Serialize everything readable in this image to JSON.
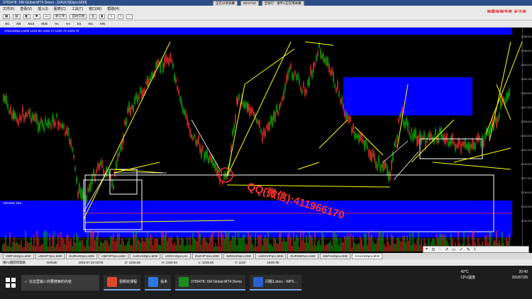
{
  "window": {
    "title": "3765478: XM Global-MT4 Demo - [XAUUSDpro,M30]"
  },
  "top_banner": [
    "正在分享屏幕",
    "00:07:53",
    "全局行 · 请平A正在用屏幕"
  ],
  "red_note": "屏幕录像专家 未注册",
  "menu": [
    "文件(F)",
    "查看(V)",
    "插入(I)",
    "图表(C)",
    "工具(T)",
    "窗口(W)",
    "帮助(H)"
  ],
  "toolbar": {
    "new_order": "新订单",
    "auto_trade": "自动交易"
  },
  "timeframes": [
    "M1",
    "M5",
    "M15",
    "M30",
    "H1",
    "H4",
    "D1",
    "W1",
    "MN"
  ],
  "chart": {
    "symbol_label": "XAUUSDpro,M30 1223.66 1223.72 1222.78 1223.70",
    "volume_label": "Volumes 164",
    "price_labels": [
      "1238.00",
      "1235.00",
      "1233.00",
      "1231.00",
      "1229.00",
      "1227.00",
      "1225.00",
      "1223.00",
      "1221.00",
      "1219.00",
      "1217.00",
      "1215.00",
      "1213.00",
      "1211.00"
    ],
    "watermark": "QQ(微信):411966170"
  },
  "colors": {
    "bull_candle": "#00c000",
    "bear_candle": "#ff3030",
    "zone": "#0000ff",
    "line": "#ffff00",
    "box": "#ffffff"
  },
  "drawing_tools": [
    "⌖",
    "⊙",
    "◌",
    "↗",
    "▭",
    "✓",
    "✎",
    "⌇"
  ],
  "symbol_tabs": [
    "GBPUSDpro,M30",
    "USDJPYpro,M30",
    "EURUSDpro,M30",
    "GBPJPYpro,M30",
    "AUDUSDpro,M30",
    "USDCADpro,H1",
    "EURJPYpro,M30",
    "NZDUSDpro,M30",
    "USDCHFpro,M30",
    "EURGBPpro,M30",
    "GBPAUDpro,M30",
    "XAUUSDpro,M30"
  ],
  "status": {
    "help": "按F1键获得帮助",
    "profile": "Default",
    "datetime": "2018.07.25 00:00",
    "o": "O: 1226.58",
    "h": "H: 1226.94",
    "l": "L: 1226.50",
    "v": "V: 1102",
    "kb": "104/0 kb"
  },
  "taskbar": [
    {
      "label": "在这里输入你要搜索的内容",
      "color": "#3a3a3a"
    },
    {
      "label": "视频收课程",
      "color": "#e04a2b"
    },
    {
      "label": "话术",
      "color": "#2b78e0"
    },
    {
      "label": "3765478: XM Global-MT4 Demo",
      "color": "#1b8b1b"
    },
    {
      "label": "问题1.docx - WPS ...",
      "color": "#2b5fd0"
    }
  ],
  "tray": {
    "temp": "42°C",
    "cpu": "CPU温度",
    "time": "20:40",
    "date": "2018/7/26"
  }
}
